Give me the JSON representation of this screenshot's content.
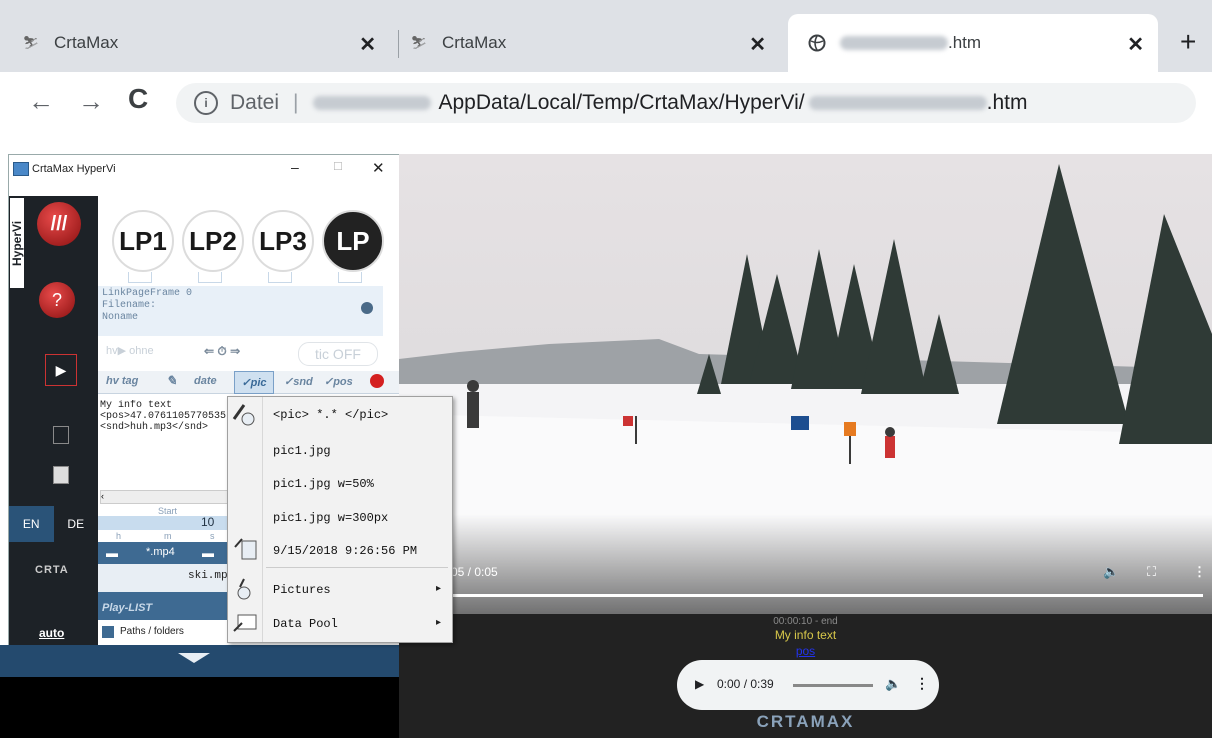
{
  "browser": {
    "tabs": [
      {
        "title": "CrtaMax",
        "close": "✕"
      },
      {
        "title": "CrtaMax",
        "close": "✕"
      },
      {
        "title": ".htm",
        "close": "✕"
      }
    ],
    "new_tab": "+",
    "nav": {
      "back": "←",
      "forward": "→",
      "reload": "C"
    },
    "address": {
      "scheme_label": "Datei",
      "path_visible": "AppData/Local/Temp/CrtaMax/HyperVi/",
      "ext": ".htm"
    }
  },
  "app": {
    "title": "CrtaMax HyperVi",
    "controls": {
      "minimize": "–",
      "maximize": "□",
      "close": "✕"
    },
    "side_title": "HyperVi",
    "lp_buttons": [
      "LP1",
      "LP2",
      "LP3",
      "LP"
    ],
    "info": {
      "line1": "LinkPageFrame 0",
      "line2": "Filename:",
      "line3": "Noname"
    },
    "tic_label": "tic OFF",
    "tag_tabs": [
      "hv tag",
      "date",
      "✓pic",
      "✓snd",
      "✓pos"
    ],
    "editor_lines": [
      "My info text",
      "<pos>47.0761105770535",
      "<snd>huh.mp3</snd>"
    ],
    "time_header": "Start",
    "time_value": "10",
    "time_units": [
      "h",
      "m",
      "s"
    ],
    "file_row": "*.mp4",
    "file_name": "ski.mp",
    "playlist_label": "Play-LIST",
    "paths_label": "Paths / folders",
    "lang": {
      "en": "EN",
      "de": "DE"
    },
    "auto_label": "auto",
    "logo_text": "CRTA",
    "help_label": "?"
  },
  "context_menu": {
    "items": [
      "<pic> *.* </pic>",
      "pic1.jpg",
      "pic1.jpg w=50%",
      "pic1.jpg w=300px",
      "9/15/2018 9:26:56 PM",
      "Pictures",
      "Data Pool"
    ],
    "submenu_arrow": "▸"
  },
  "video": {
    "time": "05 / 0:05",
    "progress": 1.0
  },
  "overlay": {
    "time_range": "00:00:10 - end",
    "info": "My info text",
    "link": "pos"
  },
  "audio": {
    "time": "0:00 / 0:39",
    "progress": 0.0
  },
  "footer_logo": "CRTAMAX",
  "colors": {
    "accent_blue": "#3e6a92",
    "panel_dark": "#1d2227",
    "overlay_yellow": "#d8c84a",
    "link_blue": "#2233ee"
  }
}
